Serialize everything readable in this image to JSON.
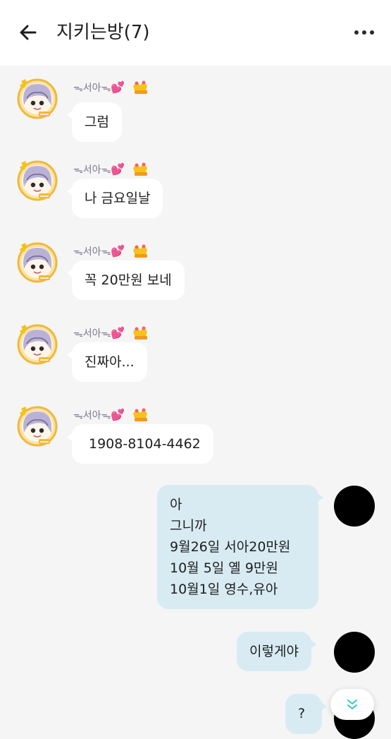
{
  "header": {
    "title": "지키는방(7)",
    "back_icon": "arrow-left-icon",
    "more_icon": "more-horizontal-icon"
  },
  "sender": {
    "name_prefix": "ᯓ서아ᯓ",
    "heart": "💕"
  },
  "messages_in": [
    {
      "text": "그럼"
    },
    {
      "text": "나 금요일날"
    },
    {
      "text": "꼭 20만원 보네"
    },
    {
      "text": "진짜아..."
    },
    {
      "text": "1908-8104-4462"
    }
  ],
  "messages_out": [
    {
      "text": "아\n그니까\n9월26일 서아20만원\n10월 5일 옐 9만원\n10월1일 영수,유아"
    },
    {
      "text": "이렇게야"
    },
    {
      "text": "?"
    }
  ],
  "scroll_button_icon": "double-chevron-down-icon",
  "colors": {
    "accent": "#2ec6d6",
    "bubble_out": "#d8ebf3",
    "bubble_in": "#ffffff",
    "background": "#f5f5f5"
  }
}
